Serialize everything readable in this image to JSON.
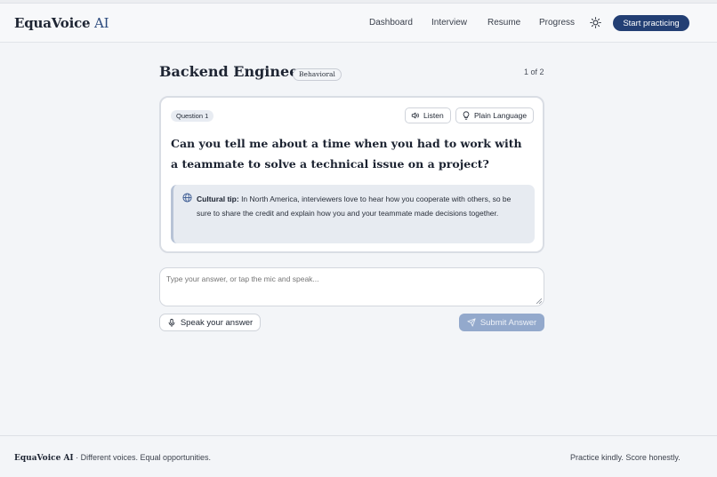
{
  "header": {
    "logo_main": "EquaVoice",
    "logo_ai": " AI",
    "nav": [
      {
        "label": "Dashboard"
      },
      {
        "label": "Interview"
      },
      {
        "label": "Resume"
      },
      {
        "label": "Progress"
      }
    ],
    "theme_icon": "sun-icon",
    "cta_label": "Start practicing"
  },
  "session": {
    "title": "Backend Engineer",
    "tag": "Behavioral",
    "counter": "1 of 2"
  },
  "question_card": {
    "badge": "Question 1",
    "listen_label": "Listen",
    "listen_icon": "speaker-icon",
    "plain_label": "Plain Language",
    "plain_icon": "lightbulb-icon",
    "question_text": "Can you tell me about a time when you had to work with a teammate to solve a technical issue on a project?",
    "tip": {
      "icon": "globe-icon",
      "label": "Cultural tip:",
      "text": " In North America, interviewers love to hear how you cooperate with others, so be sure to share the credit and explain how you and your teammate made decisions together."
    }
  },
  "answer": {
    "placeholder": "Type your answer, or tap the mic and speak...",
    "speak_label": "Speak your answer",
    "speak_icon": "microphone-icon",
    "submit_label": "Submit Answer",
    "submit_icon": "send-icon"
  },
  "footer": {
    "brand": "EquaVoice AI",
    "tagline": " · Different voices. Equal opportunities.",
    "right": "Practice kindly. Score honestly."
  },
  "colors": {
    "primary": "#233f74",
    "submit_disabled": "#93a9cc",
    "background": "#f3f5f8"
  }
}
